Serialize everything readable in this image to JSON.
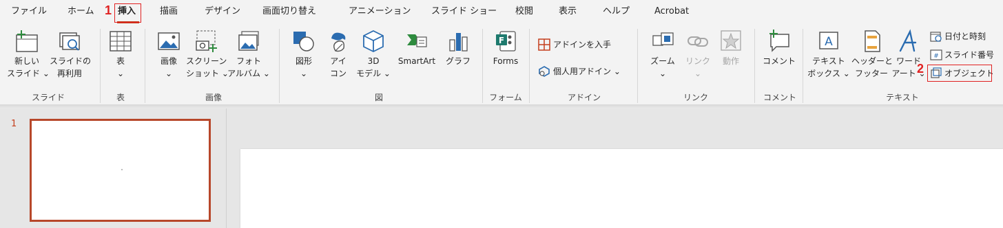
{
  "tabs": [
    "ファイル",
    "ホーム",
    "挿入",
    "描画",
    "デザイン",
    "画面切り替え",
    "アニメーション",
    "スライド ショー",
    "校閲",
    "表示",
    "ヘルプ",
    "Acrobat"
  ],
  "callouts": [
    "1",
    "2"
  ],
  "ribbon": {
    "slides": {
      "new_slide": [
        "新しい",
        "スライド ⌄"
      ],
      "reuse_slide": [
        "スライドの",
        "再利用"
      ],
      "group": "スライド"
    },
    "table": {
      "table_btn": [
        "表",
        "⌄"
      ],
      "group": "表"
    },
    "images": {
      "picture": [
        "画像",
        "⌄"
      ],
      "screenshot": [
        "スクリーン",
        "ショット ⌄"
      ],
      "photo_album": [
        "フォト",
        "アルバム ⌄"
      ],
      "group": "画像"
    },
    "illustrations": {
      "shapes": [
        "図形",
        "⌄"
      ],
      "icons": [
        "アイ",
        "コン"
      ],
      "models_3d": [
        "3D",
        "モデル ⌄"
      ],
      "smartart": "SmartArt",
      "chart": "グラフ",
      "group": "図"
    },
    "forms": {
      "forms_btn": "Forms",
      "group": "フォーム"
    },
    "addins": {
      "get_addins": "アドインを入手",
      "my_addins": "個人用アドイン  ⌄",
      "group": "アドイン"
    },
    "links": {
      "zoom": [
        "ズーム",
        "⌄"
      ],
      "link": [
        "リンク",
        "⌄"
      ],
      "action": "動作",
      "group": "リンク"
    },
    "comments": {
      "comment_btn": "コメント",
      "group": "コメント"
    },
    "text": {
      "textbox": [
        "テキスト",
        "ボックス ⌄"
      ],
      "header_footer": [
        "ヘッダーと",
        "フッター"
      ],
      "wordart": [
        "ワード",
        "アート ⌄"
      ],
      "date_time": "日付と時刻",
      "slide_number": "スライド番号",
      "object": "オブジェクト",
      "group": "テキスト"
    }
  },
  "slides_pane": {
    "slide_number": "1"
  },
  "colors": {
    "accent": "#c43e1c",
    "callout": "#e02020",
    "thumb_border": "#b7472a",
    "icon_blue": "#2b6cb0"
  }
}
